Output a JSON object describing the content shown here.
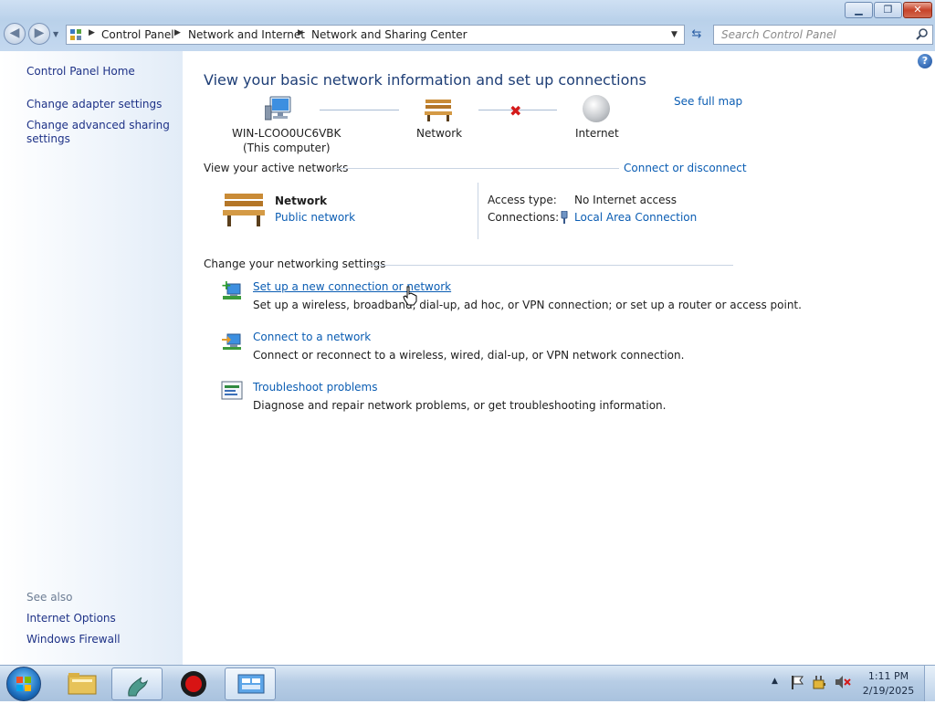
{
  "window": {
    "minimize_icon": "minimize-icon",
    "maximize_icon": "restore-icon",
    "close_icon": "close-icon"
  },
  "address": {
    "crumbs": [
      "Control Panel",
      "Network and Internet",
      "Network and Sharing Center"
    ],
    "search_placeholder": "Search Control Panel"
  },
  "sidebar": {
    "home": "Control Panel Home",
    "items": [
      "Change adapter settings",
      "Change advanced sharing",
      "settings"
    ],
    "see_also": "See also",
    "see_also_items": [
      "Internet Options",
      "Windows Firewall"
    ]
  },
  "main": {
    "heading": "View your basic network information and set up connections",
    "see_full_map": "See full map",
    "map": {
      "computer_name": "WIN-LCOO0UC6VBK",
      "computer_sub": "(This computer)",
      "network": "Network",
      "internet": "Internet"
    },
    "active_networks_label": "View your active networks",
    "connect_disconnect": "Connect or disconnect",
    "active_network": {
      "name": "Network",
      "type": "Public network",
      "access_label": "Access type:",
      "access_value": "No Internet access",
      "connections_label": "Connections:",
      "connections_value": "Local Area Connection"
    },
    "change_settings_label": "Change your networking settings",
    "tasks": [
      {
        "title": "Set up a new connection or network",
        "desc": "Set up a wireless, broadband, dial-up, ad hoc, or VPN connection; or set up a router or access point."
      },
      {
        "title": "Connect to a network",
        "desc": "Connect or reconnect to a wireless, wired, dial-up, or VPN network connection."
      },
      {
        "title": "Troubleshoot problems",
        "desc": "Diagnose and repair network problems, or get troubleshooting information."
      }
    ]
  },
  "taskbar": {
    "time": "1:11 PM",
    "date": "2/19/2025"
  },
  "colors": {
    "link": "#0b5db3",
    "sidebar_link": "#1e3287",
    "error_x": "#d41a1a"
  }
}
